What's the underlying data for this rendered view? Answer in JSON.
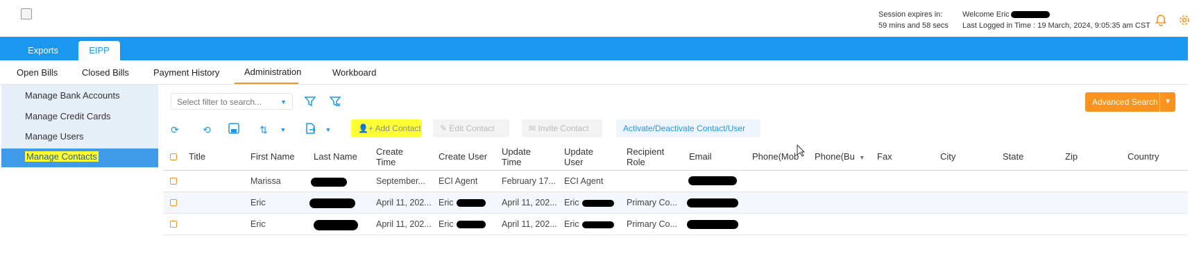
{
  "header": {
    "session_label": "Session expires in:",
    "session_value": "59 mins and 58 secs",
    "welcome": "Welcome Eric",
    "last_logged": "Last Logged in Time : 19 March, 2024, 9:05:35 am CST",
    "bell_icon": "bell-icon",
    "gear_icon": "gear-icon"
  },
  "top_tabs": [
    "Exports",
    "EIPP"
  ],
  "sub_nav": [
    "Open Bills",
    "Closed Bills",
    "Payment History",
    "Administration",
    "Workboard"
  ],
  "sidebar": [
    "Manage Bank Accounts",
    "Manage Credit Cards",
    "Manage Users",
    "Manage Contacts"
  ],
  "filter": {
    "placeholder": "Select filter to search...",
    "advanced_search": "Advanced Search"
  },
  "toolbar": {
    "add_contact": "Add Contact",
    "edit_contact": "Edit Contact",
    "invite_contact": "Invite Contact",
    "activate": "Activate/Deactivate Contact/User"
  },
  "table": {
    "columns": [
      "Title",
      "First Name",
      "Last Name",
      "Create Time",
      "Create User",
      "Update Time",
      "Update User",
      "Recipient Role",
      "Email",
      "Phone(Mob",
      "Phone(Bu",
      "Fax",
      "City",
      "State",
      "Zip",
      "Country"
    ],
    "rows": [
      {
        "first": "Marissa",
        "create_time": "September...",
        "create_user": "ECI Agent",
        "update_time": "February 17...",
        "update_user": "ECI Agent",
        "role": ""
      },
      {
        "first": "Eric",
        "create_time": "April 11, 202...",
        "create_user": "Eric",
        "update_time": "April 11, 202...",
        "update_user": "Eric",
        "role": "Primary Co..."
      },
      {
        "first": "Eric",
        "create_time": "April 11, 202...",
        "create_user": "Eric",
        "update_time": "April 11, 202...",
        "update_user": "Eric",
        "role": "Primary Co..."
      }
    ]
  },
  "colors": {
    "accent": "#1a98ef",
    "orange": "#f7931e",
    "highlight": "#ffff33"
  }
}
